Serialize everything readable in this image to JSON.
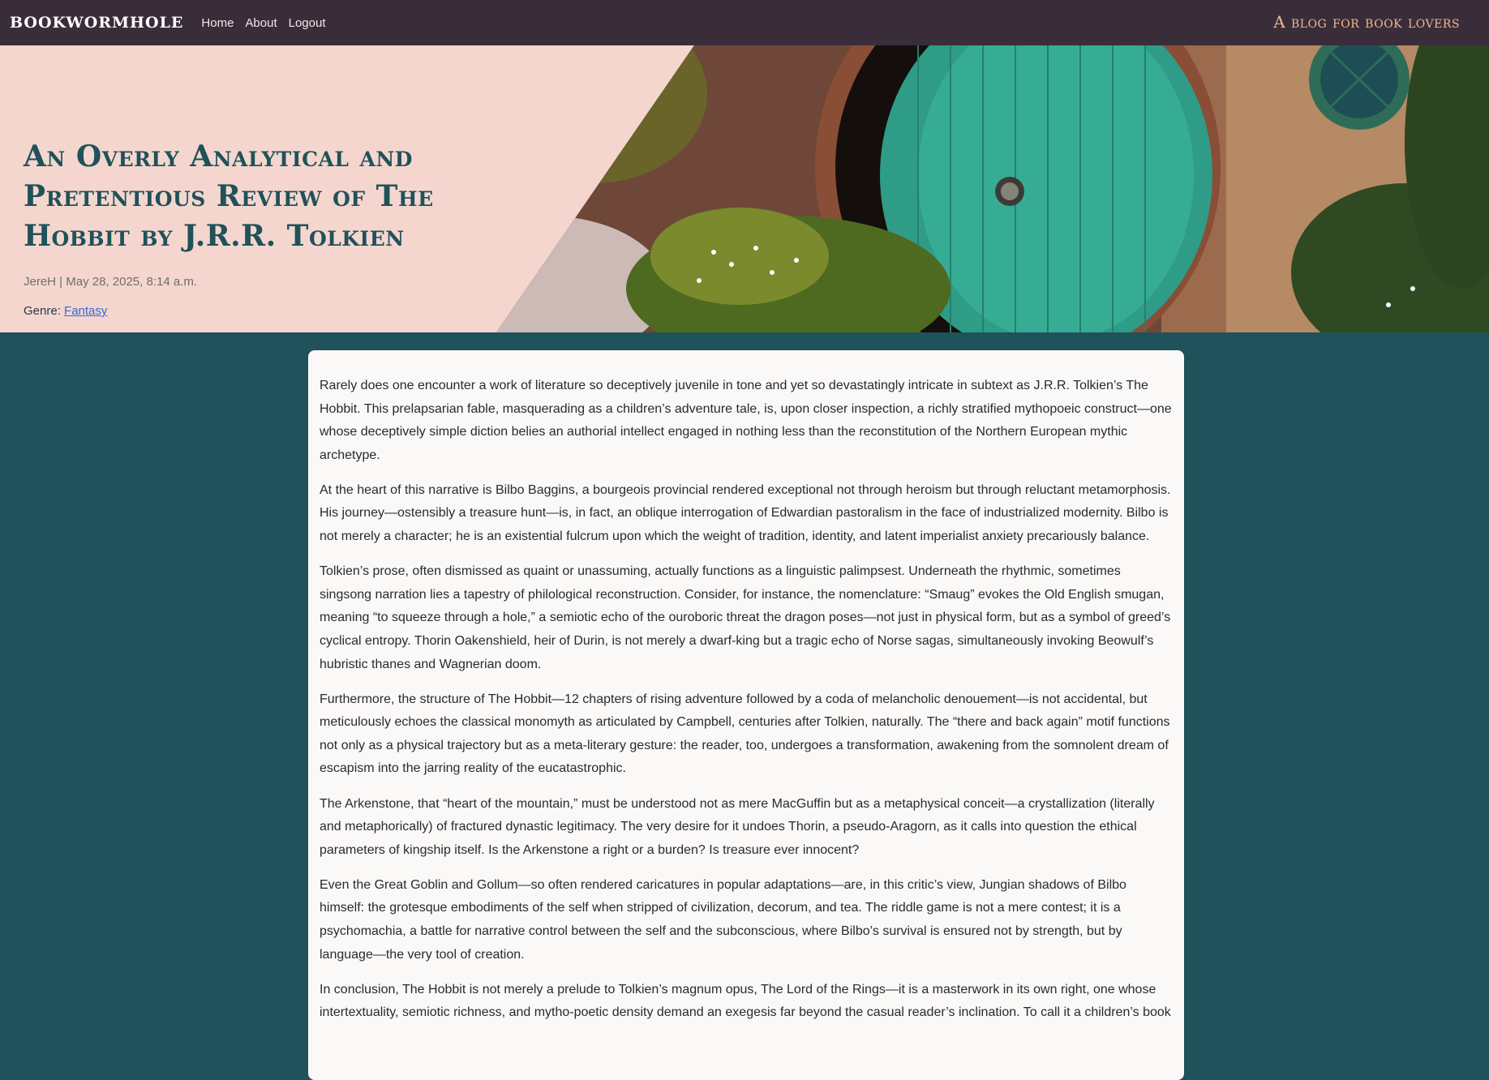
{
  "nav": {
    "brand": "BOOKWORMHOLE",
    "links": [
      "Home",
      "About",
      "Logout"
    ],
    "tagline": "A blog for book lovers"
  },
  "hero": {
    "title": "An Overly Analytical and Pretentious Review of The Hobbit by J.R.R. Tolkien",
    "meta": "JereH | May 28, 2025, 8:14 a.m.",
    "genre_label": "Genre: ",
    "genre_link": "Fantasy"
  },
  "article": {
    "paragraphs": [
      "Rarely does one encounter a work of literature so deceptively juvenile in tone and yet so devastatingly intricate in subtext as J.R.R. Tolkien’s The Hobbit. This prelapsarian fable, masquerading as a children’s adventure tale, is, upon closer inspection, a richly stratified mythopoeic construct—one whose deceptively simple diction belies an authorial intellect engaged in nothing less than the reconstitution of the Northern European mythic archetype.",
      "At the heart of this narrative is Bilbo Baggins, a bourgeois provincial rendered exceptional not through heroism but through reluctant metamorphosis. His journey—ostensibly a treasure hunt—is, in fact, an oblique interrogation of Edwardian pastoralism in the face of industrialized modernity. Bilbo is not merely a character; he is an existential fulcrum upon which the weight of tradition, identity, and latent imperialist anxiety precariously balance.",
      "Tolkien’s prose, often dismissed as quaint or unassuming, actually functions as a linguistic palimpsest. Underneath the rhythmic, sometimes singsong narration lies a tapestry of philological reconstruction. Consider, for instance, the nomenclature: “Smaug” evokes the Old English smugan, meaning “to squeeze through a hole,” a semiotic echo of the ouroboric threat the dragon poses—not just in physical form, but as a symbol of greed’s cyclical entropy. Thorin Oakenshield, heir of Durin, is not merely a dwarf-king but a tragic echo of Norse sagas, simultaneously invoking Beowulf’s hubristic thanes and Wagnerian doom.",
      "Furthermore, the structure of The Hobbit—12 chapters of rising adventure followed by a coda of melancholic denouement—is not accidental, but meticulously echoes the classical monomyth as articulated by Campbell, centuries after Tolkien, naturally. The “there and back again” motif functions not only as a physical trajectory but as a meta-literary gesture: the reader, too, undergoes a transformation, awakening from the somnolent dream of escapism into the jarring reality of the eucatastrophic.",
      "The Arkenstone, that “heart of the mountain,” must be understood not as mere MacGuffin but as a metaphysical conceit—a crystallization (literally and metaphorically) of fractured dynastic legitimacy. The very desire for it undoes Thorin, a pseudo-Aragorn, as it calls into question the ethical parameters of kingship itself. Is the Arkenstone a right or a burden? Is treasure ever innocent?",
      "Even the Great Goblin and Gollum—so often rendered caricatures in popular adaptations—are, in this critic’s view, Jungian shadows of Bilbo himself: the grotesque embodiments of the self when stripped of civilization, decorum, and tea. The riddle game is not a mere contest; it is a psychomachia, a battle for narrative control between the self and the subconscious, where Bilbo’s survival is ensured not by strength, but by language—the very tool of creation.",
      "In conclusion, The Hobbit is not merely a prelude to Tolkien’s magnum opus, The Lord of the Rings—it is a masterwork in its own right, one whose intertextuality, semiotic richness, and mytho-poetic density demand an exegesis far beyond the casual reader’s inclination. To call it a children’s book"
    ]
  }
}
